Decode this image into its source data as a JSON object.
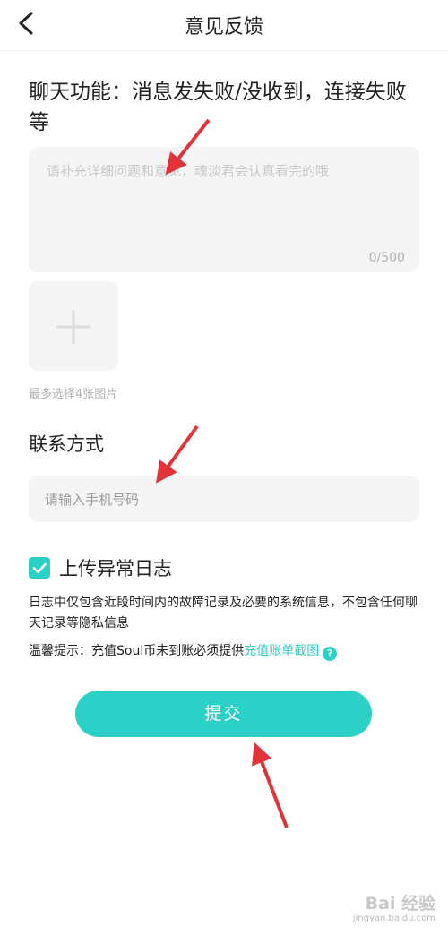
{
  "header": {
    "title": "意见反馈"
  },
  "category": {
    "text": "聊天功能：消息发失败/没收到，连接失败等"
  },
  "feedback": {
    "placeholder": "请补充详细问题和意见，魂淡君会认真看完的哦",
    "counter": "0/500"
  },
  "images": {
    "hint": "最多选择4张图片"
  },
  "contact": {
    "label": "联系方式",
    "placeholder": "请输入手机号码"
  },
  "upload_log": {
    "checked": true,
    "label": "上传异常日志",
    "note": "日志中仅包含近段时间内的故障记录及必要的系统信息，不包含任何聊天记录等隐私信息"
  },
  "tip": {
    "prefix": "温馨提示：充值Soul币未到账必须提供",
    "link": "充值账单截图",
    "help": "?"
  },
  "submit": {
    "label": "提交"
  },
  "watermark": {
    "main": "Bai 经验",
    "sub": "jingyan.baidu.com"
  },
  "colors": {
    "accent": "#2cd0c6",
    "annotation_arrow": "#e0343a",
    "field_bg": "#f5f5f5"
  }
}
